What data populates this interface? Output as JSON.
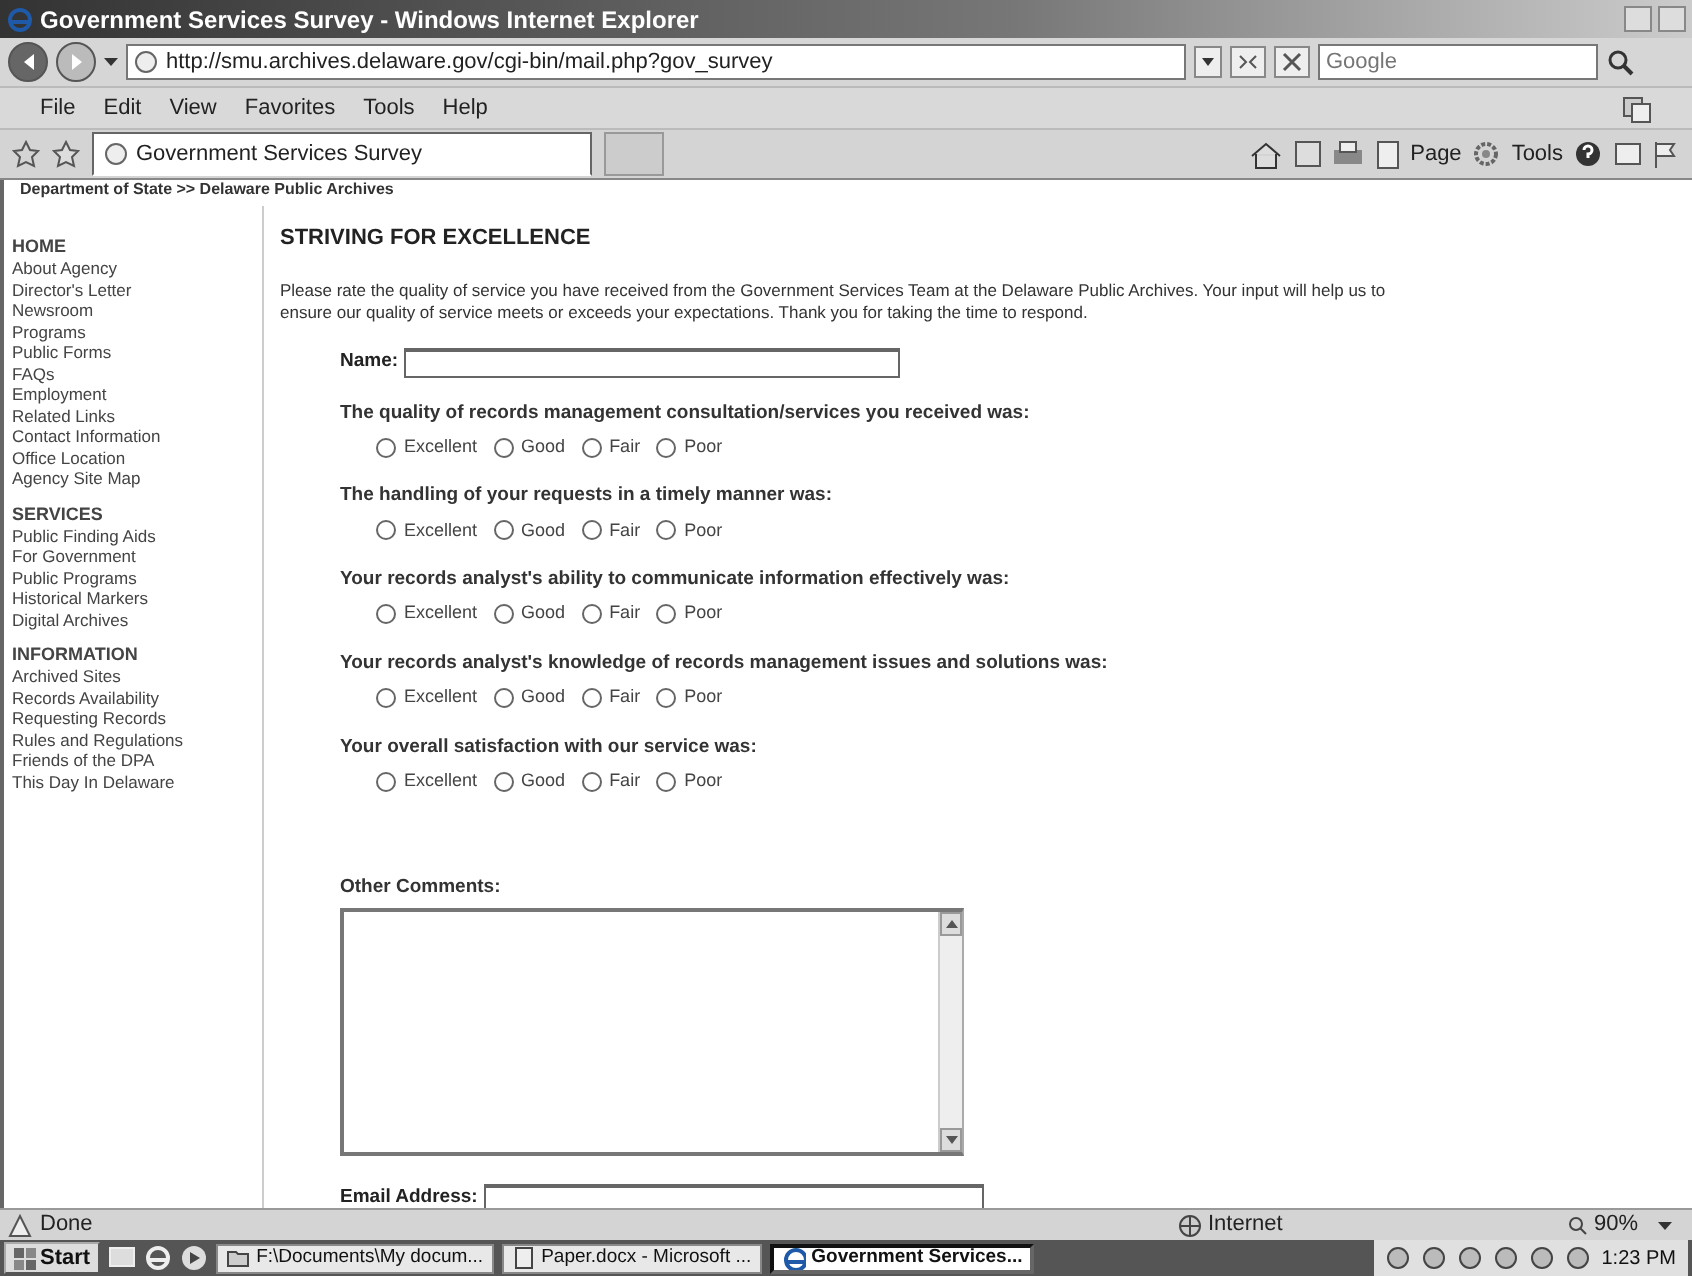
{
  "window": {
    "title": "Government Services Survey - Windows Internet Explorer"
  },
  "address_bar": {
    "url": "http://smu.archives.delaware.gov/cgi-bin/mail.php?gov_survey",
    "search_placeholder": "Google"
  },
  "menu": [
    "File",
    "Edit",
    "View",
    "Favorites",
    "Tools",
    "Help"
  ],
  "tab": {
    "title": "Government Services Survey",
    "selected": true
  },
  "command_bar": [
    "Page",
    "Tools"
  ],
  "breadcrumb": "Department of State >> Delaware Public Archives",
  "sidebar": [
    {
      "heading": "HOME",
      "items": [
        "About Agency",
        "Director's Letter",
        "Newsroom",
        "Programs",
        "Public Forms",
        "FAQs",
        "Employment",
        "Related Links",
        "Contact Information",
        "Office Location",
        "Agency Site Map"
      ]
    },
    {
      "heading": "SERVICES",
      "items": [
        "Public Finding Aids",
        "For Government",
        "Public Programs",
        "Historical Markers",
        "Digital Archives"
      ]
    },
    {
      "heading": "INFORMATION",
      "items": [
        "Archived Sites",
        "Records Availability",
        "Requesting Records",
        "Rules and Regulations",
        "Friends of the DPA",
        "This Day In Delaware"
      ]
    }
  ],
  "page": {
    "title": "STRIVING FOR EXCELLENCE",
    "intro": "Please rate the quality of service you have received from the Government Services Team at the Delaware Public Archives. Your input will help us to ensure our quality of service meets or exceeds your expectations. Thank you for taking the time to respond.",
    "name_label": "Name:",
    "questions": [
      {
        "text": "The quality of records management consultation/services you received was:",
        "choices": [
          {
            "label": "Excellent",
            "selected": false
          },
          {
            "label": "Good",
            "selected": false
          },
          {
            "label": "Fair",
            "selected": false
          },
          {
            "label": "Poor",
            "selected": false
          }
        ]
      },
      {
        "text": "The handling of your requests in a timely manner was:",
        "choices": [
          {
            "label": "Excellent",
            "selected": false
          },
          {
            "label": "Good",
            "selected": false
          },
          {
            "label": "Fair",
            "selected": false
          },
          {
            "label": "Poor",
            "selected": false
          }
        ]
      },
      {
        "text": "Your records analyst's ability to communicate information effectively was:",
        "choices": [
          {
            "label": "Excellent",
            "selected": false
          },
          {
            "label": "Good",
            "selected": false
          },
          {
            "label": "Fair",
            "selected": false
          },
          {
            "label": "Poor",
            "selected": false
          }
        ]
      },
      {
        "text": "Your records analyst's knowledge of records management issues and solutions was:",
        "choices": [
          {
            "label": "Excellent",
            "selected": false
          },
          {
            "label": "Good",
            "selected": false
          },
          {
            "label": "Fair",
            "selected": false
          },
          {
            "label": "Poor",
            "selected": false
          }
        ]
      },
      {
        "text": "Your overall satisfaction with our service was:",
        "choices": [
          {
            "label": "Excellent",
            "selected": false
          },
          {
            "label": "Good",
            "selected": false
          },
          {
            "label": "Fair",
            "selected": false
          },
          {
            "label": "Poor",
            "selected": false
          }
        ]
      }
    ],
    "comments_label": "Other Comments:",
    "email_label": "Email Address:"
  },
  "status_bar": {
    "status": "Done",
    "zone": "Internet",
    "zoom": "90%"
  },
  "taskbar": {
    "start": "Start",
    "tasks": [
      {
        "title": "F:\\Documents\\My docum...",
        "selected": false
      },
      {
        "title": "Paper.docx - Microsoft ...",
        "selected": false
      },
      {
        "title": "Government Services...",
        "selected": true
      }
    ],
    "clock": "1:23 PM"
  }
}
